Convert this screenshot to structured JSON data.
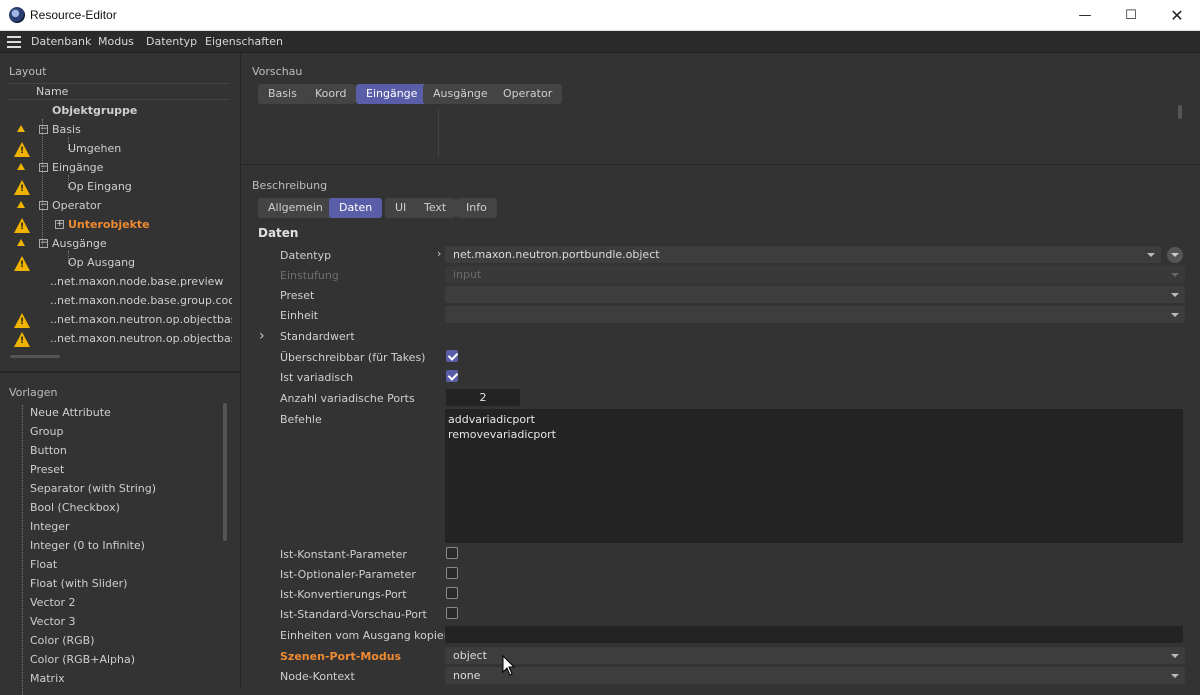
{
  "window": {
    "title": "Resource-Editor"
  },
  "menu": [
    "Datenbank",
    "Modus",
    "Datentyp",
    "Eigenschaften"
  ],
  "layout": {
    "label": "Layout",
    "column": "Name",
    "rows": [
      {
        "text": "Objektgruppe",
        "bold": true
      },
      {
        "text": "Basis",
        "toggle": "−"
      },
      {
        "text": "Umgehen"
      },
      {
        "text": "Eingänge",
        "toggle": "−"
      },
      {
        "text": "Op Eingang"
      },
      {
        "text": "Operator",
        "toggle": "−"
      },
      {
        "text": "Unterobjekte",
        "toggle": "+",
        "orange": true
      },
      {
        "text": "Ausgänge",
        "toggle": "−"
      },
      {
        "text": "Op Ausgang"
      },
      {
        "text": "..net.maxon.node.base.preview"
      },
      {
        "text": "..net.maxon.node.base.group.coord"
      },
      {
        "text": "..net.maxon.neutron.op.objectbase.ch"
      },
      {
        "text": "..net.maxon.neutron.op.objectbase.ch"
      }
    ]
  },
  "templates": {
    "label": "Vorlagen",
    "items": [
      "Neue Attribute",
      "Group",
      "Button",
      "Preset",
      "Separator (with String)",
      "Bool (Checkbox)",
      "Integer",
      "Integer (0 to Infinite)",
      "Float",
      "Float (with Slider)",
      "Vector 2",
      "Vector 3",
      "Color (RGB)",
      "Color (RGB+Alpha)",
      "Matrix"
    ]
  },
  "preview": {
    "label": "Vorschau",
    "tabs": [
      "Basis",
      "Koord",
      "Eingänge",
      "Ausgänge",
      "Operator"
    ],
    "active_tab": "Eingänge"
  },
  "description": {
    "label": "Beschreibung",
    "tabs": [
      "Allgemein",
      "Daten",
      "UI",
      "Text",
      "Info"
    ],
    "active_tab": "Daten",
    "section_title": "Daten",
    "datentyp": {
      "label": "Datentyp",
      "value": "net.maxon.neutron.portbundle.object"
    },
    "einstufung": {
      "label": "Einstufung",
      "value": "input"
    },
    "preset": {
      "label": "Preset",
      "value": ""
    },
    "einheit": {
      "label": "Einheit",
      "value": ""
    },
    "standardwert": {
      "label": "Standardwert"
    },
    "ueberschreibbar": {
      "label": "Überschreibbar (für Takes)",
      "checked": true
    },
    "variadisch": {
      "label": "Ist variadisch",
      "checked": true
    },
    "anzahl": {
      "label": "Anzahl variadische Ports",
      "value": "2"
    },
    "befehle": {
      "label": "Befehle",
      "value": "addvariadicport\nremovevariadicport"
    },
    "konstant": {
      "label": "Ist-Konstant-Parameter",
      "checked": false
    },
    "optional": {
      "label": "Ist-Optionaler-Parameter",
      "checked": false
    },
    "konvertierung": {
      "label": "Ist-Konvertierungs-Port",
      "checked": false
    },
    "vorschau": {
      "label": "Ist-Standard-Vorschau-Port",
      "checked": false
    },
    "einheiten_kopieren": {
      "label": "Einheiten vom Ausgang kopieren",
      "value": ""
    },
    "szenen_port": {
      "label": "Szenen-Port-Modus",
      "value": "object"
    },
    "node_kontext": {
      "label": "Node-Kontext",
      "value": "none"
    }
  },
  "colors": {
    "accent": "#5a5ea8",
    "warning": "#f0b400",
    "highlight": "#ee8a30"
  }
}
